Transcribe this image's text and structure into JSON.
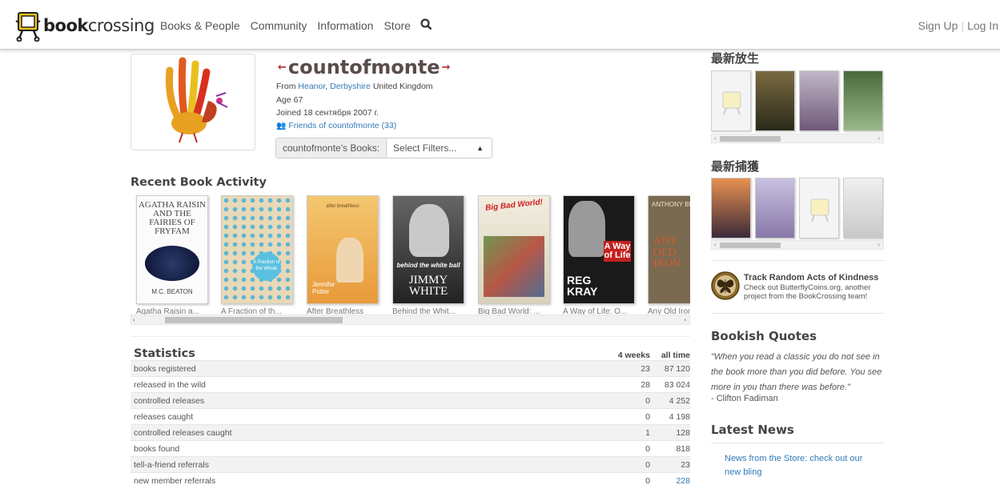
{
  "nav": {
    "logo_bold": "book",
    "logo_rest": "crossing",
    "links": [
      "Books & People",
      "Community",
      "Information",
      "Store"
    ],
    "signup": "Sign Up",
    "sep": "|",
    "login": "Log In"
  },
  "profile": {
    "username": "countofmonte",
    "from_prefix": "From",
    "town": "Heanor",
    "county": "Derbyshire",
    "country": "United Kingdom",
    "age": "Age 67",
    "joined": "Joined 18 сентября 2007 г.",
    "friends": "Friends of countofmonte (33)",
    "books_label": "countofmonte's Books:",
    "filter_placeholder": "Select Filters..."
  },
  "recent": {
    "title": "Recent Book Activity",
    "books": [
      {
        "caption": "Agatha Raisin a...",
        "cover_title": "AGATHA RAISIN AND THE FAIRIES OF FRYFAM",
        "author": "M.C. BEATON"
      },
      {
        "caption": "A Fraction of th...",
        "cover_title": "A Fraction of the Whole",
        "author": ""
      },
      {
        "caption": "After Breathless",
        "cover_title": "after breathless",
        "author": "Jennifer Potter"
      },
      {
        "caption": "Behind the Whit...",
        "cover_title": "behind the white ball",
        "author": "JIMMY WHITE"
      },
      {
        "caption": "Big Bad World: ...",
        "cover_title": "Big Bad World!",
        "author": ""
      },
      {
        "caption": "A Way of Life: O...",
        "cover_title": "A Way of Life",
        "author": "REG KRAY"
      },
      {
        "caption": "Any Old Iron",
        "cover_title": "ANY OLD IRON",
        "author": "ANTHONY BURGESS"
      }
    ]
  },
  "stats": {
    "title": "Statistics",
    "col1": "4 weeks",
    "col2": "all time",
    "rows": [
      {
        "name": "books registered",
        "w": "23",
        "a": "87 120"
      },
      {
        "name": "released in the wild",
        "w": "28",
        "a": "83 024"
      },
      {
        "name": "controlled releases",
        "w": "0",
        "a": "4 252"
      },
      {
        "name": "releases caught",
        "w": "0",
        "a": "4 198"
      },
      {
        "name": "controlled releases caught",
        "w": "1",
        "a": "128"
      },
      {
        "name": "books found",
        "w": "0",
        "a": "818"
      },
      {
        "name": "tell-a-friend referrals",
        "w": "0",
        "a": "23"
      },
      {
        "name": "new member referrals",
        "w": "0",
        "a": "228"
      }
    ]
  },
  "sidebar": {
    "latest_released": "最新放生",
    "latest_caught": "最新捕獲",
    "track_title": "Track Random Acts of Kindness",
    "track_text": "Check out ButterflyCoins.org, another project from the BookCrossing team!",
    "quotes_title": "Bookish Quotes",
    "quote": "\"When you read a classic you do not see in the book more than you did before. You see more in you than there was before.\"",
    "quote_author": "- Clifton Fadiman",
    "news_title": "Latest News",
    "news_item": "News from the Store: check out our new bling"
  },
  "colors": {
    "link": "#337ab7",
    "username": "#5a4b4b",
    "row_alt": "#f2f2f2"
  }
}
